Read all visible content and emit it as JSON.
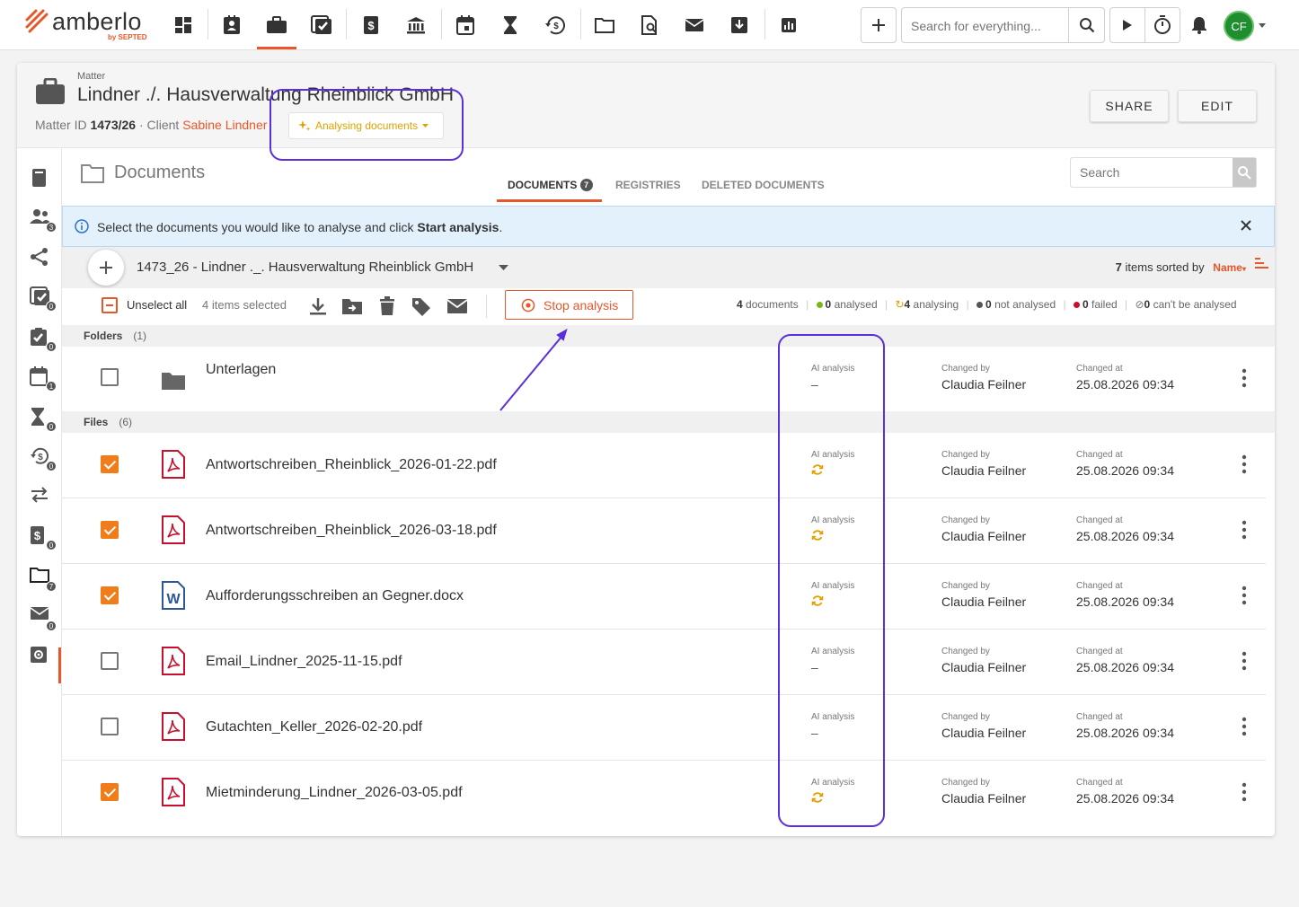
{
  "topbar": {
    "logo_word": "amberlo",
    "logo_by": "by SEPTED",
    "search_placeholder": "Search for everything...",
    "avatar_initials": "CF",
    "nav_icons": [
      "dashboard-icon",
      "contacts-icon",
      "matters-icon",
      "tasks-icon",
      "billing-icon",
      "bank-icon",
      "calendar-icon",
      "hourglass-icon",
      "time-history-icon",
      "folder-icon",
      "document-search-icon",
      "mail-icon",
      "inbox-download-icon",
      "reports-icon"
    ]
  },
  "matter": {
    "kicker": "Matter",
    "title": "Lindner ./. Hausverwaltung Rheinblick GmbH",
    "id_label": "Matter ID",
    "id_value": "1473/26",
    "client_label": "Client",
    "client_name": "Sabine Lindner",
    "analysing_label": "Analysing documents",
    "share_label": "SHARE",
    "edit_label": "EDIT"
  },
  "sidebar": {
    "badges": {
      "contacts": "3",
      "tasks": "0",
      "checked": "0",
      "events": "1",
      "hourglass": "0",
      "time": "0",
      "billing": "0",
      "documents": "7",
      "mail": "0"
    }
  },
  "documents": {
    "title": "Documents",
    "tabs": [
      {
        "label": "DOCUMENTS",
        "badge": "7"
      },
      {
        "label": "REGISTRIES"
      },
      {
        "label": "DELETED DOCUMENTS"
      }
    ],
    "search_placeholder": "Search",
    "info_text_pre": "Select the documents you would like to analyse and click ",
    "info_text_bold": "Start analysis",
    "info_text_post": ".",
    "path": "1473_26 - Lindner ._. Hausverwaltung Rheinblick GmbH",
    "sort_count": "7",
    "sort_text": "items sorted by",
    "sort_field": "Name",
    "unselect_all": "Unselect all",
    "items_selected": "4 items selected",
    "stop_analysis": "Stop analysis",
    "stats": {
      "documents_count": "4",
      "documents_label": "documents",
      "analysed_count": "0",
      "analysed_label": "analysed",
      "analysing_count": "4",
      "analysing_label": "analysing",
      "not_analysed_count": "0",
      "not_analysed_label": "not analysed",
      "failed_count": "0",
      "failed_label": "failed",
      "cant_count": "0",
      "cant_label": "can't be analysed"
    },
    "folders_label": "Folders",
    "folders_count": "(1)",
    "files_label": "Files",
    "files_count": "(6)",
    "col_ai": "AI analysis",
    "col_changed_by": "Changed by",
    "col_changed_at": "Changed at",
    "folder_row": {
      "name": "Unterlagen",
      "ai": "–",
      "changed_by": "Claudia Feilner",
      "changed_at": "25.08.2026 09:34"
    },
    "files": [
      {
        "name": "Antwortschreiben_Rheinblick_2026-01-22.pdf",
        "type": "pdf",
        "checked": true,
        "ai": "analysing",
        "changed_by": "Claudia Feilner",
        "changed_at": "25.08.2026 09:34"
      },
      {
        "name": "Antwortschreiben_Rheinblick_2026-03-18.pdf",
        "type": "pdf",
        "checked": true,
        "ai": "analysing",
        "changed_by": "Claudia Feilner",
        "changed_at": "25.08.2026 09:34"
      },
      {
        "name": "Aufforderungsschreiben an Gegner.docx",
        "type": "docx",
        "checked": true,
        "ai": "analysing",
        "changed_by": "Claudia Feilner",
        "changed_at": "25.08.2026 09:34"
      },
      {
        "name": "Email_Lindner_2025-11-15.pdf",
        "type": "pdf",
        "checked": false,
        "ai": "–",
        "changed_by": "Claudia Feilner",
        "changed_at": "25.08.2026 09:34"
      },
      {
        "name": "Gutachten_Keller_2026-02-20.pdf",
        "type": "pdf",
        "checked": false,
        "ai": "–",
        "changed_by": "Claudia Feilner",
        "changed_at": "25.08.2026 09:34"
      },
      {
        "name": "Mietminderung_Lindner_2026-03-05.pdf",
        "type": "pdf",
        "checked": true,
        "ai": "analysing",
        "changed_by": "Claudia Feilner",
        "changed_at": "25.08.2026 09:34"
      }
    ]
  },
  "colors": {
    "accent": "#e8572a",
    "checkbox": "#f07c1a",
    "analysing": "#e0a000",
    "annotation": "#5b2fdb",
    "info_bg": "#e3f1fd",
    "avatar": "#1e8e2e"
  }
}
